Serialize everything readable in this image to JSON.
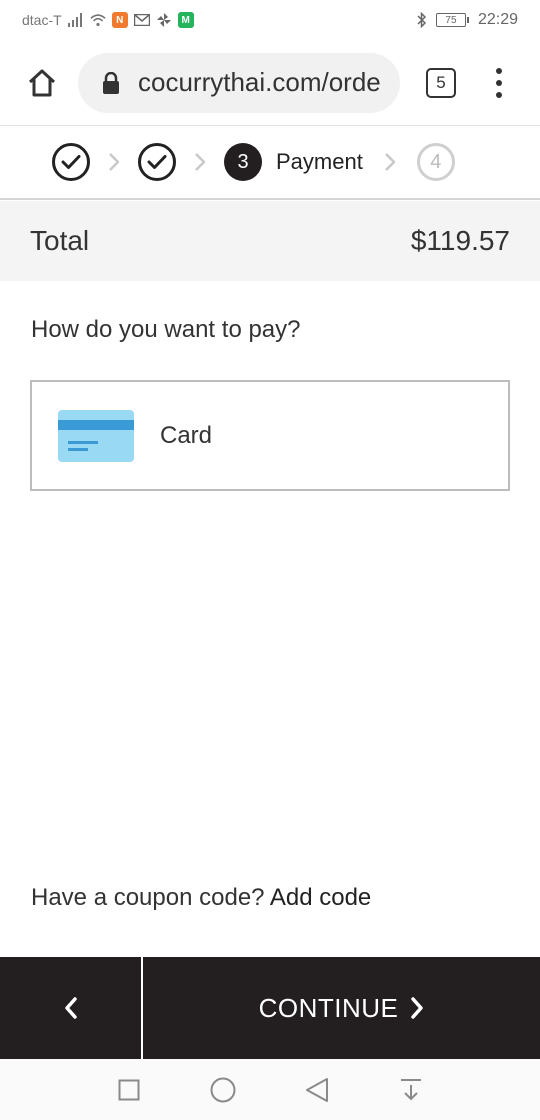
{
  "status_bar": {
    "carrier": "dtac-T",
    "battery_level": "75",
    "time": "22:29",
    "app_badge_1_text": "N",
    "app_badge_2_text": "M",
    "colors": {
      "badge_orange": "#f07b2e",
      "badge_green": "#25b35c"
    }
  },
  "browser": {
    "url": "cocurrythai.com/orde",
    "tab_count": "5"
  },
  "stepper": {
    "steps": [
      {
        "state": "done"
      },
      {
        "state": "done"
      },
      {
        "state": "active",
        "number": "3",
        "label": "Payment"
      },
      {
        "state": "future",
        "number": "4"
      }
    ]
  },
  "total": {
    "label": "Total",
    "amount": "$119.57"
  },
  "payment": {
    "question": "How do you want to pay?",
    "options": [
      {
        "label": "Card",
        "icon": "credit-card-icon"
      }
    ],
    "colors": {
      "card_body": "#9ad9f4",
      "card_stripe": "#3a9ad6"
    }
  },
  "coupon": {
    "prompt": "Have a coupon code?",
    "link": "Add code"
  },
  "actions": {
    "continue_label": "CONTINUE",
    "bar_color": "#231f20"
  }
}
